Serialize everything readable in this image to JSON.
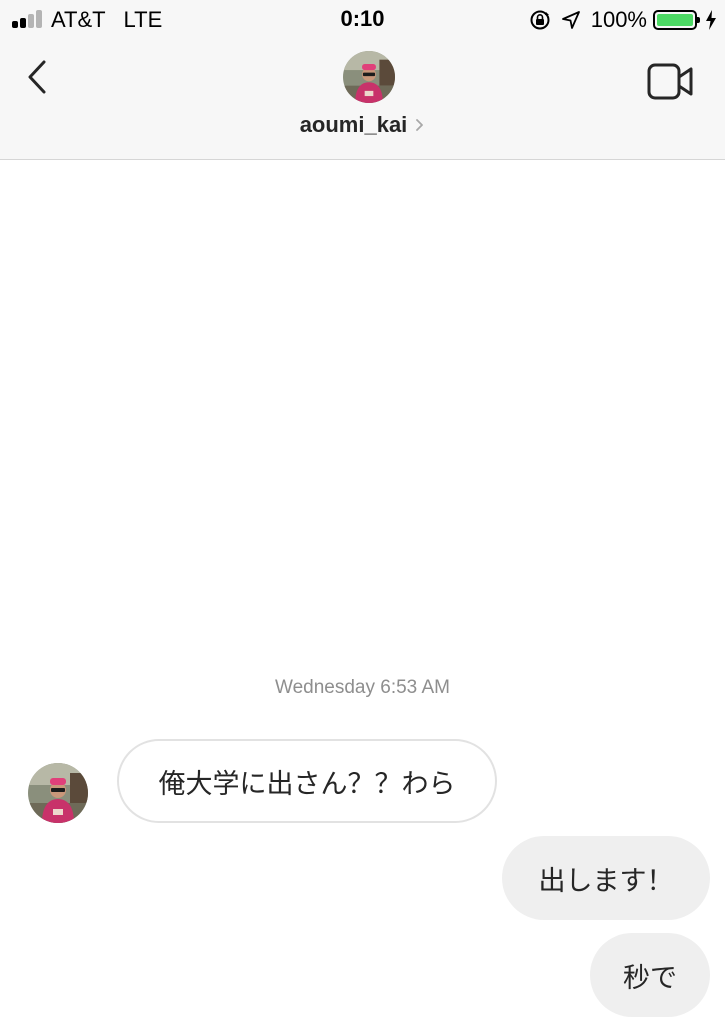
{
  "status_bar": {
    "carrier": "AT&T",
    "network": "LTE",
    "time": "0:10",
    "battery_percent": "100%",
    "battery_level": 1.0,
    "signal_bars_active": 2,
    "signal_bars_total": 4,
    "icons": [
      "rotation-lock-icon",
      "location-arrow-icon",
      "battery-icon",
      "charging-bolt-icon"
    ]
  },
  "header": {
    "username": "aoumi_kai",
    "back_icon": "chevron-left-icon",
    "video_icon": "video-camera-icon",
    "title_chevron_icon": "chevron-right-icon"
  },
  "conversation": {
    "date_label": "Wednesday 6:53 AM",
    "messages": [
      {
        "direction": "incoming",
        "text": "俺大学に出さん？？わら"
      },
      {
        "direction": "outgoing",
        "text": "出します！"
      },
      {
        "direction": "outgoing",
        "text": "秒で"
      }
    ]
  },
  "colors": {
    "header_background": "#f7f7f7",
    "outgoing_bubble": "#efefef",
    "incoming_bubble_border": "#e2e2e2",
    "date_text": "#8e8e8e",
    "battery_fill": "#4cd964",
    "avatar_shirt": "#c8326a"
  }
}
